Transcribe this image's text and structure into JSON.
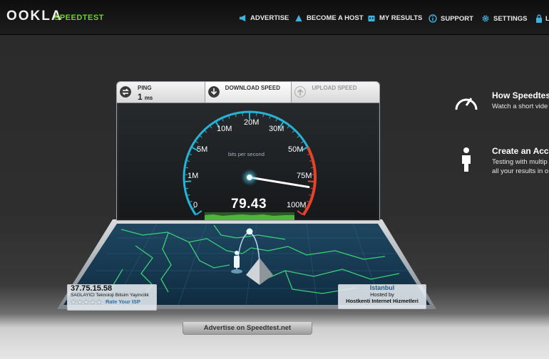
{
  "header": {
    "logo": "OOKLA",
    "product": "SPEEDTEST",
    "nav": [
      {
        "label": "ADVERTISE",
        "icon": "megaphone-icon"
      },
      {
        "label": "BECOME A HOST",
        "icon": "host-icon"
      },
      {
        "label": "MY RESULTS",
        "icon": "results-icon"
      },
      {
        "label": "SUPPORT",
        "icon": "info-icon"
      },
      {
        "label": "SETTINGS",
        "icon": "gear-icon"
      },
      {
        "label": "L",
        "icon": "lock-icon"
      }
    ]
  },
  "tabs": {
    "ping": {
      "label": "PING",
      "value": "1",
      "unit": "ms"
    },
    "download": {
      "label": "DOWNLOAD SPEED"
    },
    "upload": {
      "label": "UPLOAD SPEED"
    }
  },
  "gauge": {
    "units_label": "bits per second",
    "current_speed": "79.43",
    "needle_value": 79.43,
    "ticks": [
      "0",
      "1M",
      "5M",
      "10M",
      "20M",
      "30M",
      "50M",
      "75M",
      "100M"
    ]
  },
  "client": {
    "ip": "37.75.15.58",
    "isp": "SAGLAYICI Teknoloji Bilisim Yayincilik",
    "rate_label": "Rate Your ISP",
    "stars": 5
  },
  "server": {
    "city": "Istanbul",
    "hosted_by_label": "Hosted by",
    "host": "Hostkenti Internet Hizmetleri"
  },
  "promo": {
    "video_title": "How Speedtes",
    "video_text": "Watch a short vide",
    "account_title": "Create an Acc",
    "account_text_1": "Testing with multip",
    "account_text_2": "all your results in o"
  },
  "footer": {
    "advertise": "Advertise on Speedtest.net"
  },
  "colors": {
    "accent_green": "#6fd12d",
    "gauge_blue": "#27b3d6",
    "gauge_red": "#e2452c"
  }
}
